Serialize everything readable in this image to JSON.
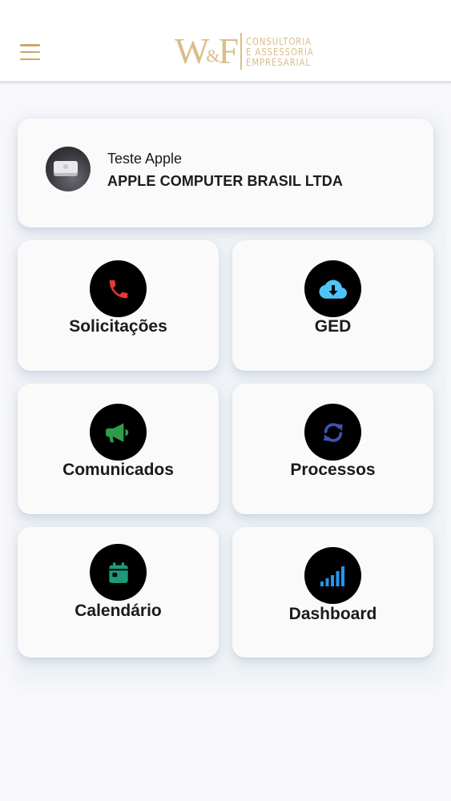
{
  "header": {
    "logo_mark": "W&F",
    "logo_lines": [
      "CONSULTORIA",
      "E ASSESSORIA",
      "EMPRESARIAL"
    ],
    "menu_icon": "hamburger-menu-icon",
    "accent_color": "#c9a66b"
  },
  "profile": {
    "name": "Teste Apple",
    "company": "APPLE COMPUTER BRASIL LTDA"
  },
  "tiles": [
    {
      "label": "Solicitações",
      "icon": "phone-icon",
      "icon_color": "#e53935"
    },
    {
      "label": "GED",
      "icon": "cloud-download-icon",
      "icon_color": "#4fc3f7"
    },
    {
      "label": "Comunicados",
      "icon": "megaphone-icon",
      "icon_color": "#2e9d4a"
    },
    {
      "label": "Processos",
      "icon": "sync-icon",
      "icon_color": "#3f51b5"
    },
    {
      "label": "Calendário",
      "icon": "calendar-icon",
      "icon_color": "#1e9a7b"
    },
    {
      "label": "Dashboard",
      "icon": "signal-bars-icon",
      "icon_color": "#2196f3"
    }
  ]
}
